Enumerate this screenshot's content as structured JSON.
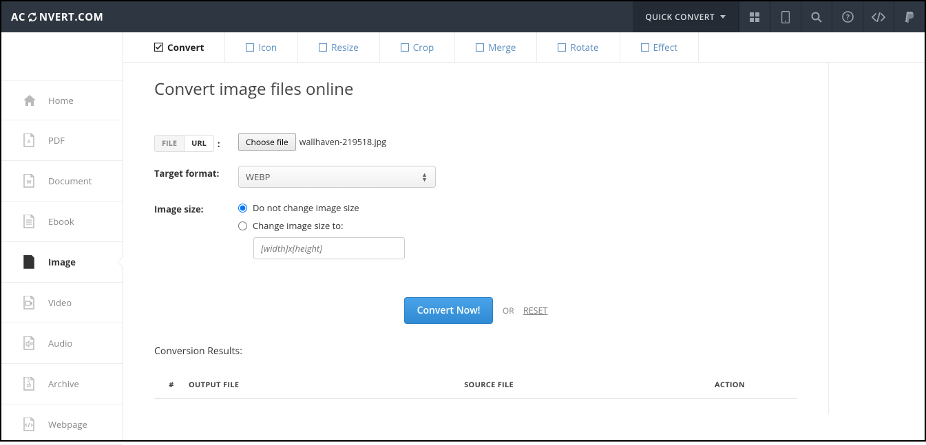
{
  "brand": {
    "left": "AC",
    "right": "NVERT.COM"
  },
  "topbar": {
    "quick_convert": "QUICK CONVERT"
  },
  "sidebar": {
    "items": [
      {
        "label": "Home",
        "icon": "home"
      },
      {
        "label": "PDF",
        "icon": "pdf"
      },
      {
        "label": "Document",
        "icon": "doc"
      },
      {
        "label": "Ebook",
        "icon": "ebook"
      },
      {
        "label": "Image",
        "icon": "image",
        "active": true
      },
      {
        "label": "Video",
        "icon": "video"
      },
      {
        "label": "Audio",
        "icon": "audio"
      },
      {
        "label": "Archive",
        "icon": "archive"
      },
      {
        "label": "Webpage",
        "icon": "webpage"
      }
    ]
  },
  "tabs": [
    {
      "label": "Convert",
      "active": true
    },
    {
      "label": "Icon"
    },
    {
      "label": "Resize"
    },
    {
      "label": "Crop"
    },
    {
      "label": "Merge"
    },
    {
      "label": "Rotate"
    },
    {
      "label": "Effect"
    }
  ],
  "heading": "Convert image files online",
  "source": {
    "toggle_file": "FILE",
    "toggle_url": "URL",
    "choose_label": "Choose file",
    "selected_filename": "wallhaven-219518.jpg"
  },
  "format": {
    "label": "Target format:",
    "value": "WEBP"
  },
  "size": {
    "label": "Image size:",
    "opt_keep": "Do not change image size",
    "opt_change": "Change image size to:",
    "placeholder": "[width]x[height]"
  },
  "buttons": {
    "convert": "Convert Now!",
    "or": "OR",
    "reset": "RESET"
  },
  "results": {
    "heading": "Conversion Results:",
    "cols": {
      "num": "#",
      "output": "OUTPUT FILE",
      "source": "SOURCE FILE",
      "action": "ACTION"
    }
  }
}
